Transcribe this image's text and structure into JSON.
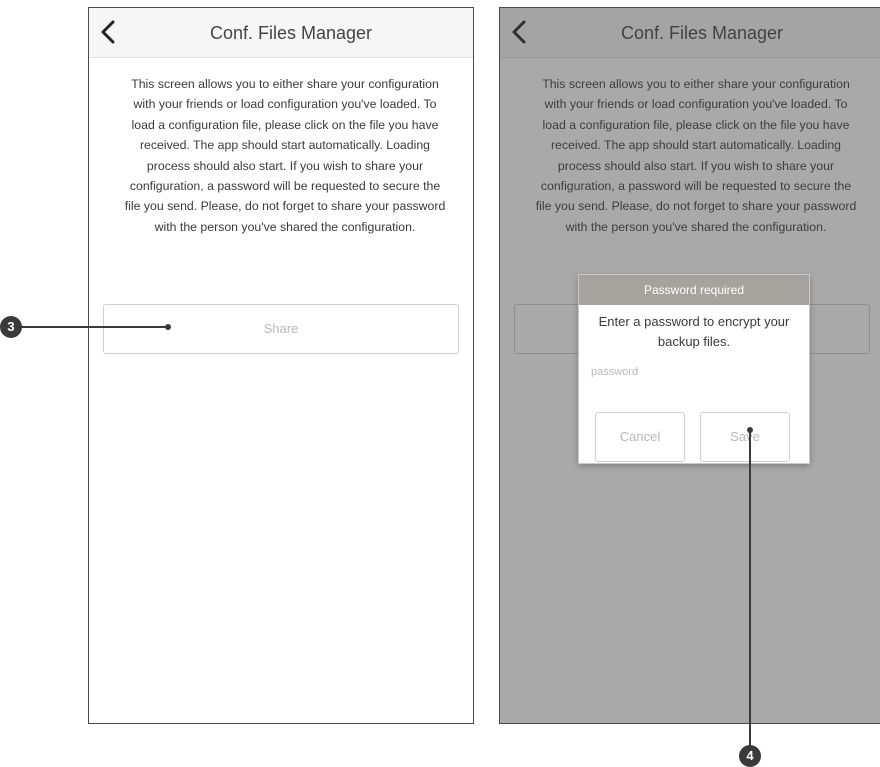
{
  "left_screen": {
    "title": "Conf. Files Manager",
    "description": "This screen allows you to either share your configuration with your friends or load configuration you've loaded. To load a configuration file, please click on the file you have received. The app should start automatically. Loading process should also start. If you wish to share your configuration, a password will be requested to secure the file you send. Please, do not forget to share your password with the person you've shared the configuration.",
    "share_label": "Share"
  },
  "right_screen": {
    "title": "Conf. Files Manager",
    "description": "This screen allows you to either share your configuration with your friends or load configuration you've loaded. To load a configuration file, please click on the file you have received. The app should start automatically. Loading process should also start. If you wish to share your configuration, a password will be requested to secure the file you send. Please, do not forget to share your password with the person you've shared the configuration.",
    "dialog": {
      "title": "Password required",
      "message": "Enter a password to encrypt your backup files.",
      "input_placeholder": "password",
      "cancel_label": "Cancel",
      "save_label": "Save"
    }
  },
  "callouts": {
    "share": "3",
    "save": "4"
  },
  "icons": {
    "back": "chevron-left-icon"
  },
  "colors": {
    "dialog_header": "#a6a29d",
    "overlay": "#7a7a7a",
    "callout": "#3a3a3a"
  }
}
